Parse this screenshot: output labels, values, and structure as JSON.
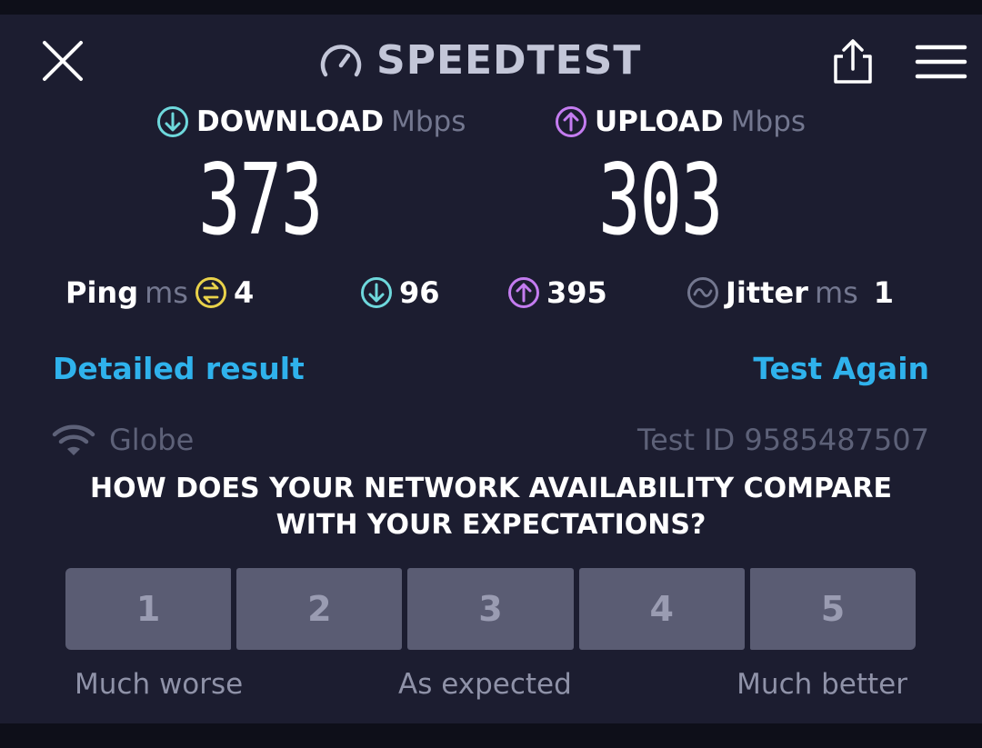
{
  "header": {
    "brand": "SPEEDTEST",
    "close_icon": "close-icon",
    "share_icon": "share-icon",
    "menu_icon": "hamburger-menu-icon"
  },
  "download": {
    "label": "DOWNLOAD",
    "unit": "Mbps",
    "value": "373",
    "color": "#6ed8dc"
  },
  "upload": {
    "label": "UPLOAD",
    "unit": "Mbps",
    "value": "303",
    "color": "#c47cf0"
  },
  "stats": {
    "ping_label": "Ping",
    "ping_unit": "ms",
    "ping_value": "4",
    "ping_color": "#e9d24a",
    "download_latency": "96",
    "upload_latency": "395",
    "jitter_label": "Jitter",
    "jitter_unit": "ms",
    "jitter_value": "1"
  },
  "actions": {
    "detailed_result": "Detailed result",
    "test_again": "Test Again"
  },
  "connection": {
    "provider": "Globe",
    "test_id": "Test ID 9585487507"
  },
  "survey": {
    "question_line1": "HOW DOES YOUR NETWORK AVAILABILITY COMPARE",
    "question_line2": "WITH YOUR EXPECTATIONS?",
    "options": [
      "1",
      "2",
      "3",
      "4",
      "5"
    ],
    "label_low": "Much worse",
    "label_mid": "As expected",
    "label_high": "Much better"
  }
}
